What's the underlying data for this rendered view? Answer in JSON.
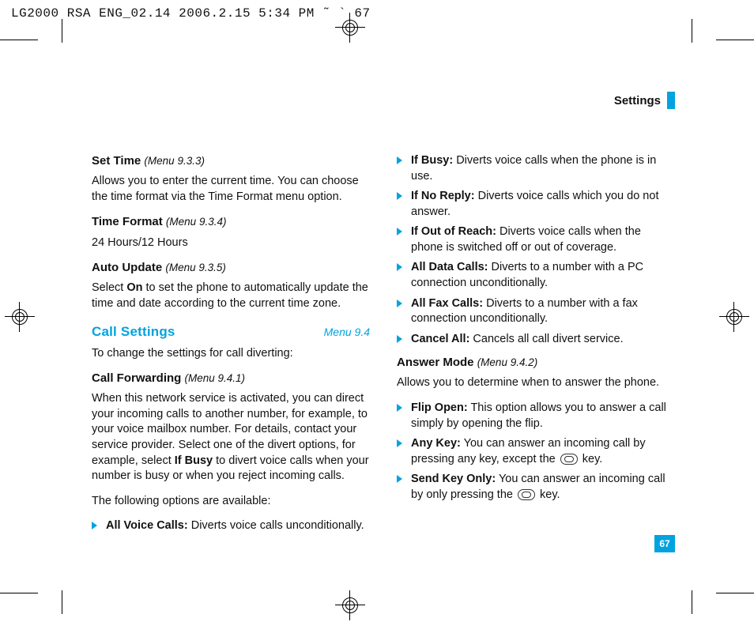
{
  "slug": "LG2000 RSA ENG_02.14  2006.2.15 5:34 PM  ˜    ` 67",
  "header": {
    "title": "Settings"
  },
  "page_number": "67",
  "left": {
    "set_time": {
      "heading": "Set Time",
      "menu_ref": "(Menu 9.3.3)",
      "body": "Allows you to enter the current time. You can choose the time format via the Time Format menu option."
    },
    "time_format": {
      "heading": "Time Format",
      "menu_ref": "(Menu 9.3.4)",
      "body": "24 Hours/12 Hours"
    },
    "auto_update": {
      "heading": "Auto Update",
      "menu_ref": "(Menu 9.3.5)",
      "body_pre": "Select ",
      "body_bold": "On",
      "body_post": " to set the phone to automatically update the time and date according to the current time zone."
    },
    "section": {
      "title": "Call Settings",
      "menu_ref": "Menu 9.4",
      "intro": "To change the settings for call diverting:"
    },
    "call_forwarding": {
      "heading": "Call Forwarding",
      "menu_ref": "(Menu 9.4.1)",
      "body_pre": "When this network service is activated, you can direct your incoming calls to another number, for example, to your voice mailbox number. For details, contact your service provider. Select one of the divert options, for example, select ",
      "body_bold": "If Busy",
      "body_post": " to divert voice calls when your number is busy or when you reject incoming calls.",
      "options_intro": "The following options are available:",
      "bullets": [
        {
          "label": "All Voice Calls:",
          "text": " Diverts voice calls unconditionally."
        }
      ]
    }
  },
  "right": {
    "cf_bullets": [
      {
        "label": "If Busy:",
        "text": " Diverts voice calls when the phone is in use."
      },
      {
        "label": "If No Reply:",
        "text": " Diverts voice calls which you do not answer."
      },
      {
        "label": "If Out of Reach:",
        "text": " Diverts voice calls when the phone is switched off or out of coverage."
      },
      {
        "label": "All Data Calls:",
        "text": " Diverts to a number with a PC connection unconditionally."
      },
      {
        "label": "All Fax Calls:",
        "text": " Diverts to a number with a fax connection unconditionally."
      },
      {
        "label": "Cancel All:",
        "text": " Cancels all call divert service."
      }
    ],
    "answer_mode": {
      "heading": "Answer Mode",
      "menu_ref": "(Menu 9.4.2)",
      "intro": "Allows you to determine when to answer the phone.",
      "bullets": [
        {
          "label": "Flip Open:",
          "text": " This option allows you to answer a call simply by opening the flip."
        },
        {
          "label": "Any Key:",
          "pre": " You can answer an incoming call by pressing any key, except the ",
          "post": " key."
        },
        {
          "label": "Send Key Only:",
          "pre": " You can answer an incoming call by only pressing the ",
          "post": " key."
        }
      ]
    }
  }
}
